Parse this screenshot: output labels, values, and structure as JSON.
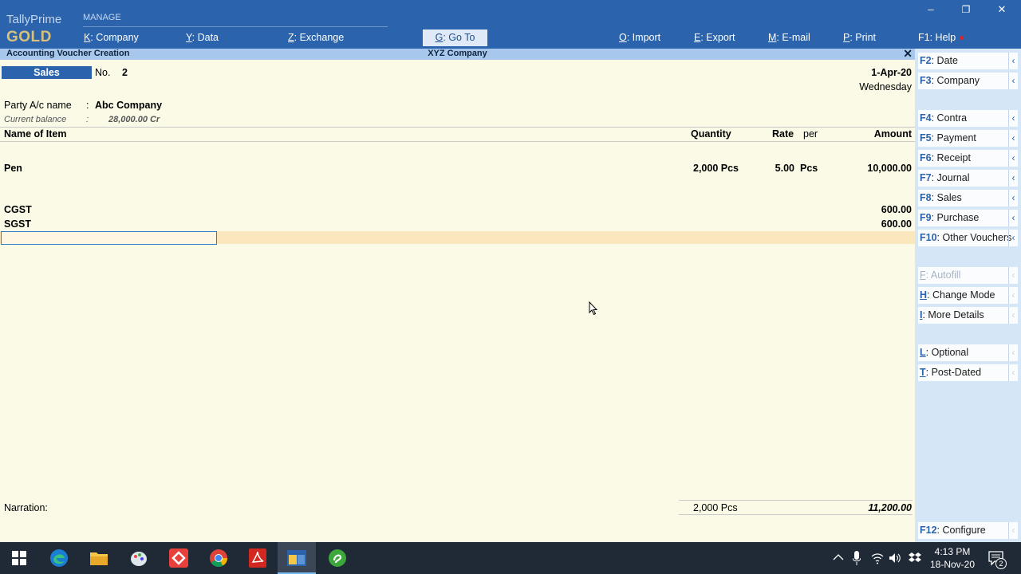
{
  "app": {
    "brand_line1": "TallyPrime",
    "brand_line2": "GOLD",
    "section_label": "MANAGE"
  },
  "menu": [
    {
      "key": "K",
      "label": ": Company"
    },
    {
      "key": "Y",
      "label": ": Data"
    },
    {
      "key": "Z",
      "label": ": Exchange"
    },
    {
      "key": "G",
      "label": ": Go To"
    },
    {
      "key": "O",
      "label": ": Import"
    },
    {
      "key": "E",
      "label": ": Export"
    },
    {
      "key": "M",
      "label": ": E-mail"
    },
    {
      "key": "P",
      "label": ": Print"
    },
    {
      "key": "F1",
      "label": ": Help"
    }
  ],
  "window_controls": {
    "minimize": "–",
    "restore": "❐",
    "close": "✕"
  },
  "titlebar": {
    "screen": "Accounting Voucher Creation",
    "company": "XYZ Company",
    "close": "✕"
  },
  "voucher": {
    "type": "Sales",
    "no_label": "No.",
    "no_value": "2",
    "date": "1-Apr-20",
    "day": "Wednesday",
    "party_label": "Party A/c name",
    "party_value": "Abc Company",
    "balance_label": "Current balance",
    "balance_value": "28,000.00 Cr",
    "colon": ":"
  },
  "columns": {
    "item": "Name of Item",
    "quantity": "Quantity",
    "rate": "Rate",
    "per": "per",
    "amount": "Amount"
  },
  "items": [
    {
      "name": "Pen",
      "quantity": "2,000 Pcs",
      "rate": "5.00",
      "per": "Pcs",
      "amount": "10,000.00"
    }
  ],
  "taxes": [
    {
      "name": "CGST",
      "amount": "600.00"
    },
    {
      "name": "SGST",
      "amount": "600.00"
    }
  ],
  "footer": {
    "narration_label": "Narration:",
    "total_quantity": "2,000 Pcs",
    "total_amount": "11,200.00"
  },
  "sidebar": [
    {
      "key": "F2",
      "label": ": Date",
      "enabled": true
    },
    {
      "key": "F3",
      "label": ": Company",
      "enabled": true
    },
    {
      "key": "F4",
      "label": ": Contra",
      "enabled": true
    },
    {
      "key": "F5",
      "label": ": Payment",
      "enabled": true
    },
    {
      "key": "F6",
      "label": ": Receipt",
      "enabled": true
    },
    {
      "key": "F7",
      "label": ": Journal",
      "enabled": true
    },
    {
      "key": "F8",
      "label": ": Sales",
      "enabled": true
    },
    {
      "key": "F9",
      "label": ": Purchase",
      "enabled": true
    },
    {
      "key": "F10",
      "label": ": Other Vouchers",
      "enabled": true
    },
    {
      "key": "F",
      "label": ": Autofill",
      "enabled": false
    },
    {
      "key": "H",
      "label": ": Change Mode",
      "enabled": true
    },
    {
      "key": "I",
      "label": ": More Details",
      "enabled": true
    },
    {
      "key": "L",
      "label": ": Optional",
      "enabled": true
    },
    {
      "key": "T",
      "label": ": Post-Dated",
      "enabled": true
    },
    {
      "key": "F12",
      "label": ": Configure",
      "enabled": true
    }
  ],
  "sidebar_arrow": "‹",
  "taskbar": {
    "time": "4:13 PM",
    "date": "18-Nov-20",
    "notification_count": "2"
  },
  "colors": {
    "tally_blue": "#2b64ac",
    "background": "#fbfae6",
    "sidebar": "#d5e6f6",
    "active_row": "#fbe7bd"
  }
}
